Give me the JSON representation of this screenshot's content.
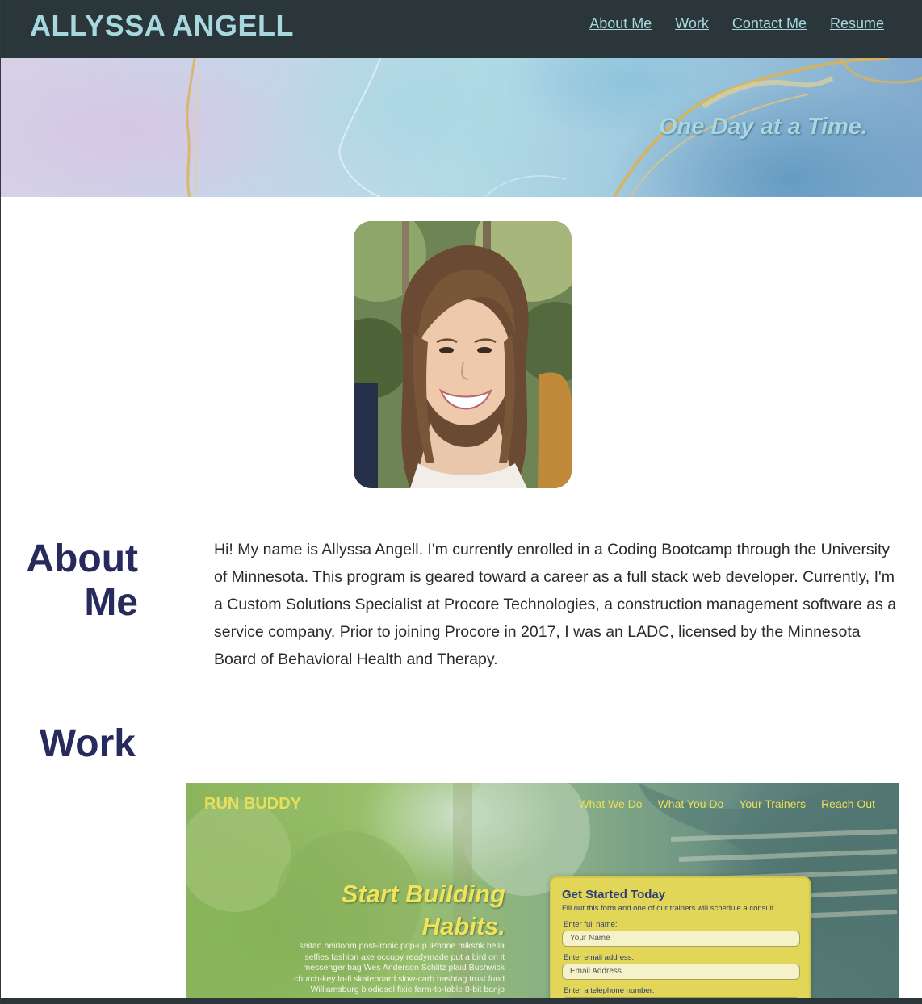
{
  "header": {
    "logo": "ALLYSSA ANGELL",
    "nav": [
      {
        "label": "About Me"
      },
      {
        "label": "Work"
      },
      {
        "label": "Contact Me"
      },
      {
        "label": "Resume"
      }
    ]
  },
  "hero": {
    "tagline": "One Day at a Time."
  },
  "about": {
    "title": "About Me",
    "text": "Hi! My name is Allyssa Angell. I'm currently enrolled in a Coding Bootcamp through the University of Minnesota. This program is geared toward a career as a full stack web developer. Currently, I'm a Custom Solutions Specialist at Procore Technologies, a construction management software as a service company. Prior to joining Procore in 2017, I was an LADC, licensed by the Minnesota Board of Behavioral Health and Therapy."
  },
  "work": {
    "title": "Work",
    "project": {
      "logo": "RUN BUDDY",
      "nav": [
        "What We Do",
        "What You Do",
        "Your Trainers",
        "Reach Out"
      ],
      "headline": "Start Building Habits.",
      "body": "seitan heirloom post-ironic pop-up iPhone mlkshk hella selfies fashion axe occupy readymade put a bird on it messenger bag Wes Anderson Schlitz plaid Bushwick church-key lo-fi skateboard slow-carb hashtag trust fund Williamsburg biodiesel fixie farm-to-table 8-bit banjo",
      "form": {
        "title": "Get Started Today",
        "subtitle": "Fill out this form and one of our trainers will schedule a consult",
        "name_label": "Enter full name:",
        "name_placeholder": "Your Name",
        "email_label": "Enter email address:",
        "email_placeholder": "Email Address",
        "phone_label": "Enter a telephone number:"
      }
    }
  },
  "colors": {
    "header_bg": "#2a3639",
    "accent": "#a7d8e0",
    "heading": "#262a5c",
    "project_accent": "#e8e05a"
  }
}
